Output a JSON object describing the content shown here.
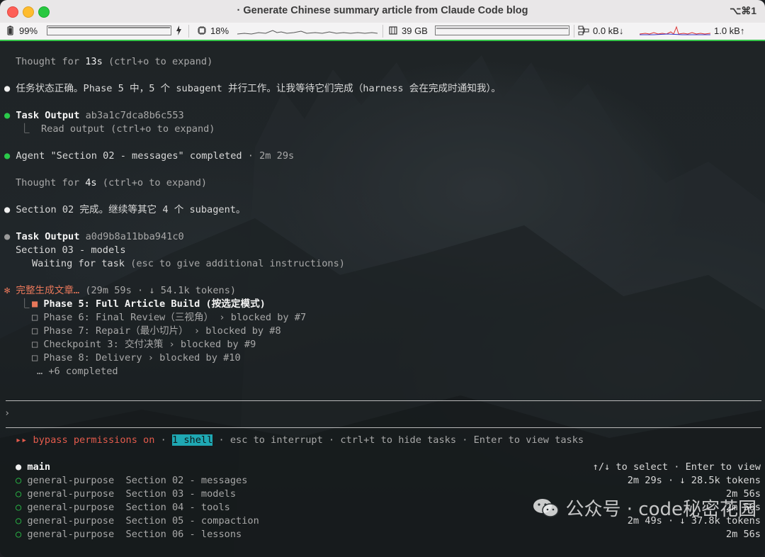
{
  "window": {
    "title": "· Generate Chinese summary article from Claude Code blog",
    "shortcut": "⌥⌘1"
  },
  "statusbar": {
    "battery": "99%",
    "cpu": "18%",
    "memory": "39 GB",
    "net_down": "0.0 kB↓",
    "net_up": "1.0 kB↑"
  },
  "terminal": {
    "thought1": {
      "prefix": "Thought for ",
      "time": "13s",
      "suffix": " (ctrl+o to expand)"
    },
    "msg1": "任务状态正确。Phase 5 中，5 个 subagent 并行工作。让我等待它们完成（harness 会在完成时通知我）。",
    "task_output1": {
      "label": "Task Output",
      "id": " ab3a1c7dca8b6c553",
      "sub": "Read output (ctrl+o to expand)"
    },
    "agent_done": {
      "text": "Agent \"Section 02 - messages\" completed",
      "meta": " · 2m 29s"
    },
    "thought2": {
      "prefix": "Thought for ",
      "time": "4s",
      "suffix": " (ctrl+o to expand)"
    },
    "msg2": "Section 02 完成。继续等其它 4 个 subagent。",
    "task_output2": {
      "label": "Task Output",
      "id": " a0d9b8a11bba941c0",
      "section": "Section 03 - models",
      "waiting": "Waiting for task",
      "waiting_hint": " (esc to give additional instructions)"
    },
    "progress": {
      "label": "完整生成文章…",
      "meta": " (29m 59s · ↓ 54.1k tokens)"
    },
    "phases": [
      {
        "marker": "■",
        "text": "Phase 5: Full Article Build (按选定模式)",
        "blocked": ""
      },
      {
        "marker": "□",
        "text": "Phase 6: Final Review（三视角）",
        "blocked": " › blocked by #7"
      },
      {
        "marker": "□",
        "text": "Phase 7: Repair（最小切片）",
        "blocked": " › blocked by #8"
      },
      {
        "marker": "□",
        "text": "Checkpoint 3: 交付决策",
        "blocked": " › blocked by #9"
      },
      {
        "marker": "□",
        "text": "Phase 8: Delivery",
        "blocked": " › blocked by #10"
      }
    ],
    "more_completed": "… +6 completed",
    "prompt": "›",
    "bypass": {
      "arrows": "▸▸",
      "label": " bypass permissions on",
      "sep1": " · ",
      "shell": "1 shell",
      "rest": " · esc to interrupt · ctrl+t to hide tasks · Enter to view tasks"
    },
    "tasks_header": {
      "name": "main",
      "hint": "↑/↓ to select · Enter to view"
    },
    "tasks": [
      {
        "type": "general-purpose",
        "name": "Section 02 - messages",
        "meta": "2m 29s · ↓ 28.5k tokens"
      },
      {
        "type": "general-purpose",
        "name": "Section 03 - models",
        "meta": "2m 56s"
      },
      {
        "type": "general-purpose",
        "name": "Section 04 - tools",
        "meta": "2m 56s"
      },
      {
        "type": "general-purpose",
        "name": "Section 05 - compaction",
        "meta": "2m 49s · ↓ 37.8k tokens"
      },
      {
        "type": "general-purpose",
        "name": "Section 06 - lessons",
        "meta": "2m 56s"
      }
    ]
  },
  "watermark": "公众号 · code秘密花园",
  "colors": {
    "accent_green": "#2ac94a",
    "accent_red": "#e35b4c",
    "highlight": "#1fa8b3"
  }
}
